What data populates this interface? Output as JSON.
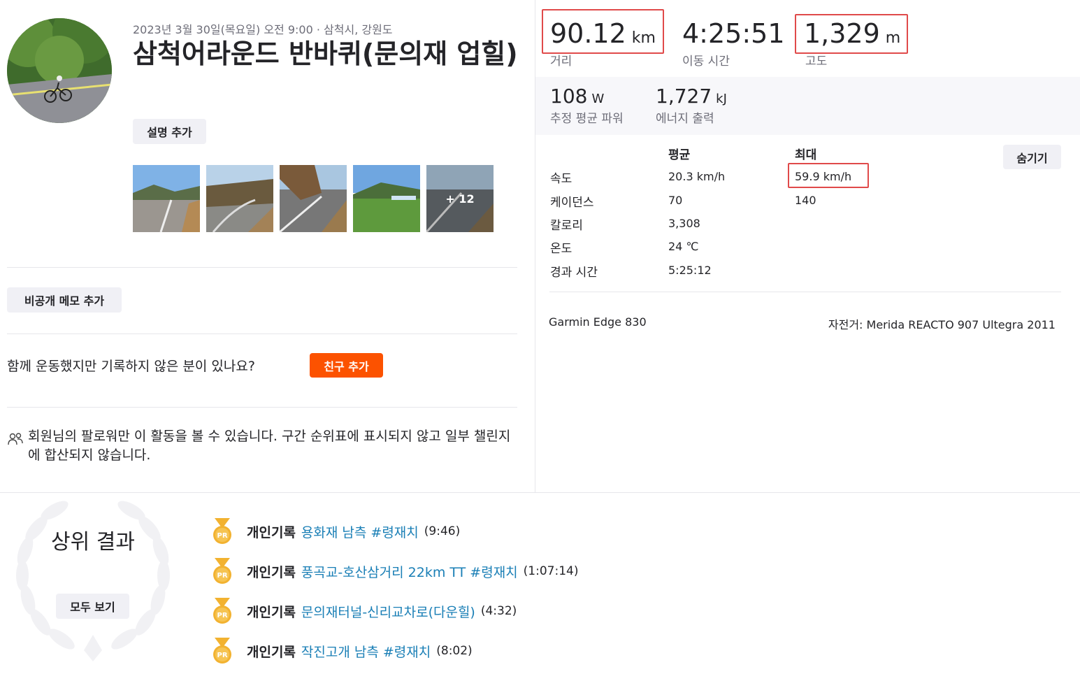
{
  "activity": {
    "meta": "2023년 3월 30일(목요일) 오전 9:00 · 삼척시, 강원도",
    "title": "삼척어라운드 반바퀴(문의재 업힐)",
    "add_description": "설명 추가",
    "more_photos": "+ 12",
    "private_note": "비공개 메모 추가",
    "with_friends_question": "함께 운동했지만 기록하지 않은 분이 있나요?",
    "add_friend": "친구 추가",
    "privacy_notice": "회원님의 팔로워만 이 활동을 볼 수 있습니다. 구간 순위표에 표시되지 않고 일부 챌린지에 합산되지 않습니다."
  },
  "stats": {
    "distance": {
      "value": "90.12",
      "unit": "km",
      "label": "거리"
    },
    "moving_time": {
      "value": "4:25:51",
      "label": "이동 시간"
    },
    "elevation": {
      "value": "1,329",
      "unit": "m",
      "label": "고도"
    },
    "power": {
      "value": "108",
      "unit": "W",
      "label": "추정 평균 파워"
    },
    "energy": {
      "value": "1,727",
      "unit": "kJ",
      "label": "에너지 출력"
    }
  },
  "details": {
    "col_avg": "평균",
    "col_max": "최대",
    "hide": "숨기기",
    "rows": [
      {
        "label": "속도",
        "avg": "20.3 km/h",
        "max": "59.9 km/h"
      },
      {
        "label": "케이던스",
        "avg": "70",
        "max": "140"
      },
      {
        "label": "칼로리",
        "avg": "3,308",
        "max": ""
      },
      {
        "label": "온도",
        "avg": "24 ℃",
        "max": ""
      },
      {
        "label": "경과 시간",
        "avg": "5:25:12",
        "max": ""
      }
    ],
    "device": "Garmin Edge 830",
    "bike": "자전거: Merida REACTO 907 Ultegra 2011"
  },
  "top_results": {
    "title": "상위 결과",
    "see_all": "모두 보기",
    "items": [
      {
        "kind": "개인기록",
        "segment": "용화재 남측 #령재치",
        "time": "(9:46)"
      },
      {
        "kind": "개인기록",
        "segment": "풍곡교-호산삼거리 22km TT #령재치",
        "time": "(1:07:14)"
      },
      {
        "kind": "개인기록",
        "segment": "문의재터널-신리교차로(다운힐)",
        "time": "(4:32)"
      },
      {
        "kind": "개인기록",
        "segment": "작진고개 남측 #령재치",
        "time": "(8:02)"
      }
    ]
  },
  "colors": {
    "brand_orange": "#fc5200",
    "link_blue": "#1a7fb6",
    "highlight_red": "#e04a4a",
    "medal_gold": "#f2b230"
  }
}
